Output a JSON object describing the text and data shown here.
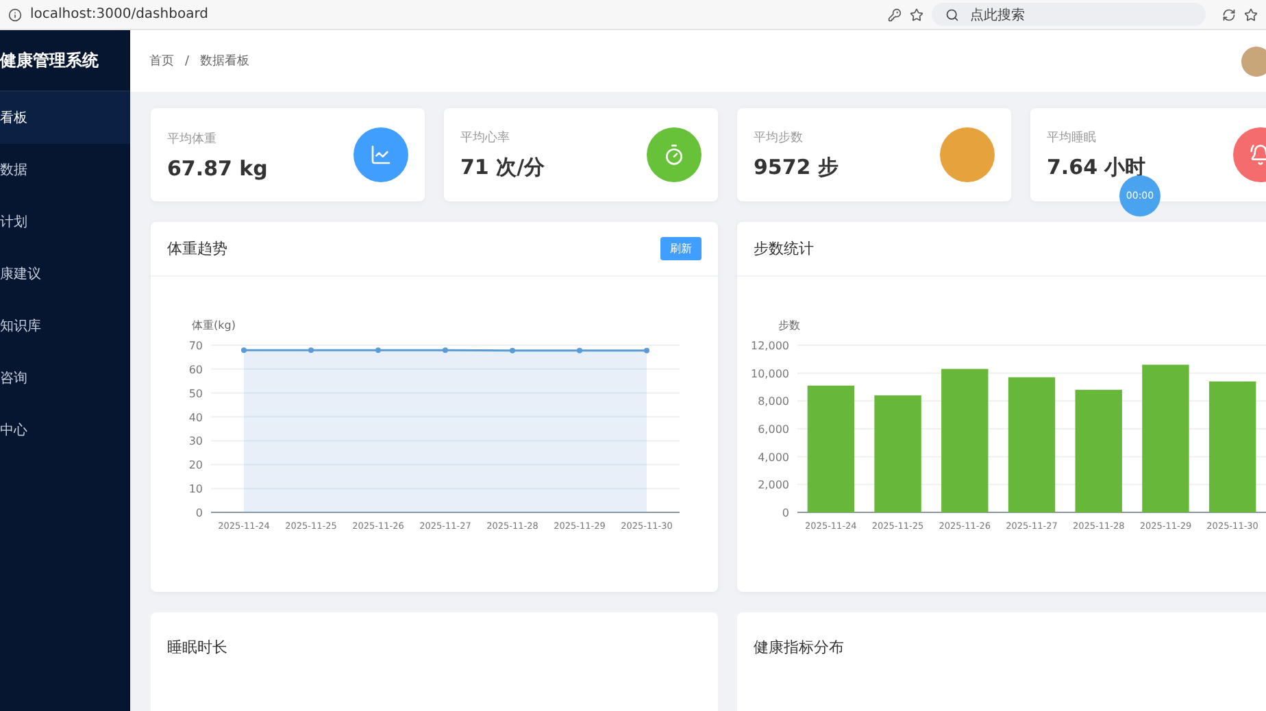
{
  "browser": {
    "url": "localhost:3000/dashboard",
    "search": {
      "placeholder": "点此搜索"
    }
  },
  "sidebar": {
    "title": "健康管理系统",
    "items": [
      {
        "label": "看板",
        "selected": true
      },
      {
        "label": "数据",
        "selected": false
      },
      {
        "label": "计划",
        "selected": false
      },
      {
        "label": "康建议",
        "selected": false
      },
      {
        "label": "知识库",
        "selected": false
      },
      {
        "label": "咨询",
        "selected": false
      },
      {
        "label": "中心",
        "selected": false
      }
    ]
  },
  "breadcrumb": {
    "items": [
      "首页",
      "数据看板"
    ],
    "separator": "/"
  },
  "stats": [
    {
      "label": "平均体重",
      "value": "67.87 kg",
      "color": "#409eff",
      "kind": "chart"
    },
    {
      "label": "平均心率",
      "value": "71 次/分",
      "color": "#67c23a",
      "kind": "timer"
    },
    {
      "label": "平均步数",
      "value": "9572 步",
      "color": "#e6a23c",
      "kind": "plain"
    },
    {
      "label": "平均睡眠",
      "value": "7.64 小时",
      "color": "#f56c6c",
      "kind": "bell"
    }
  ],
  "floating_badge": "00:00",
  "charts": [
    {
      "title": "体重趋势",
      "button": "刷新",
      "chart_data": {
        "type": "area",
        "ylabel": "体重(kg)",
        "grid": true,
        "categories": [
          "2025-11-24",
          "2025-11-25",
          "2025-11-26",
          "2025-11-27",
          "2025-11-28",
          "2025-11-29",
          "2025-11-30"
        ],
        "ylim": [
          0,
          70
        ],
        "yticks": [
          0,
          10,
          20,
          30,
          40,
          50,
          60,
          70
        ],
        "series": [
          {
            "color": "#5b9bd5",
            "values": [
              67.9,
              67.9,
              67.9,
              67.9,
              67.8,
              67.8,
              67.8
            ]
          }
        ]
      }
    },
    {
      "title": "步数统计",
      "chart_data": {
        "type": "bar",
        "ylabel": "步数",
        "grid": true,
        "categories": [
          "2025-11-24",
          "2025-11-25",
          "2025-11-26",
          "2025-11-27",
          "2025-11-28",
          "2025-11-29",
          "2025-11-30"
        ],
        "ylim": [
          0,
          12000
        ],
        "yticks": [
          {
            "value": 0,
            "label": "0"
          },
          {
            "value": 2000,
            "label": "2,000"
          },
          {
            "value": 4000,
            "label": "4,000"
          },
          {
            "value": 6000,
            "label": "6,000"
          },
          {
            "value": 8000,
            "label": "8,000"
          },
          {
            "value": 10000,
            "label": "10,000"
          },
          {
            "value": 12000,
            "label": "12,000"
          }
        ],
        "series": [
          {
            "color": "#67b83a",
            "values": [
              9100,
              8400,
              10300,
              9700,
              8800,
              10600,
              9400
            ]
          }
        ]
      }
    }
  ],
  "bottom_cards": [
    {
      "title": "睡眠时长"
    },
    {
      "title": "健康指标分布"
    }
  ]
}
